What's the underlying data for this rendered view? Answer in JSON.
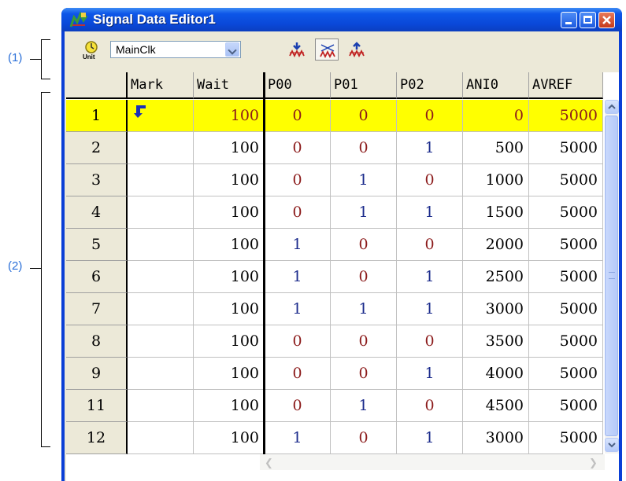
{
  "callouts": {
    "toolbar": "(1)",
    "grid": "(2)"
  },
  "window": {
    "title": "Signal Data Editor1"
  },
  "toolbar": {
    "unit_icon_label": "Unit",
    "clock_select_value": "MainClk"
  },
  "grid": {
    "columns": [
      "Mark",
      "Wait",
      "P00",
      "P01",
      "P02",
      "ANI0",
      "AVREF"
    ],
    "rows": [
      {
        "n": "1",
        "mark": "jump-arrow",
        "wait": "100",
        "p00": "0",
        "p01": "0",
        "p02": "0",
        "ani0": "0",
        "avref": "5000",
        "selected": true
      },
      {
        "n": "2",
        "mark": "",
        "wait": "100",
        "p00": "0",
        "p01": "0",
        "p02": "1",
        "ani0": "500",
        "avref": "5000"
      },
      {
        "n": "3",
        "mark": "",
        "wait": "100",
        "p00": "0",
        "p01": "1",
        "p02": "0",
        "ani0": "1000",
        "avref": "5000"
      },
      {
        "n": "4",
        "mark": "",
        "wait": "100",
        "p00": "0",
        "p01": "1",
        "p02": "1",
        "ani0": "1500",
        "avref": "5000"
      },
      {
        "n": "5",
        "mark": "",
        "wait": "100",
        "p00": "1",
        "p01": "0",
        "p02": "0",
        "ani0": "2000",
        "avref": "5000"
      },
      {
        "n": "6",
        "mark": "",
        "wait": "100",
        "p00": "1",
        "p01": "0",
        "p02": "1",
        "ani0": "2500",
        "avref": "5000"
      },
      {
        "n": "7",
        "mark": "",
        "wait": "100",
        "p00": "1",
        "p01": "1",
        "p02": "1",
        "ani0": "3000",
        "avref": "5000"
      },
      {
        "n": "8",
        "mark": "",
        "wait": "100",
        "p00": "0",
        "p01": "0",
        "p02": "0",
        "ani0": "3500",
        "avref": "5000"
      },
      {
        "n": "9",
        "mark": "",
        "wait": "100",
        "p00": "0",
        "p01": "0",
        "p02": "1",
        "ani0": "4000",
        "avref": "5000"
      },
      {
        "n": "11",
        "mark": "",
        "wait": "100",
        "p00": "0",
        "p01": "1",
        "p02": "0",
        "ani0": "4500",
        "avref": "5000"
      },
      {
        "n": "12",
        "mark": "",
        "wait": "100",
        "p00": "1",
        "p01": "0",
        "p02": "1",
        "ani0": "3000",
        "avref": "5000"
      }
    ]
  },
  "colors": {
    "zero_value": "#8b1a1a",
    "one_value": "#1a2a8b",
    "selected_row": "#ffff00",
    "titlebar": "#0a48d8"
  }
}
